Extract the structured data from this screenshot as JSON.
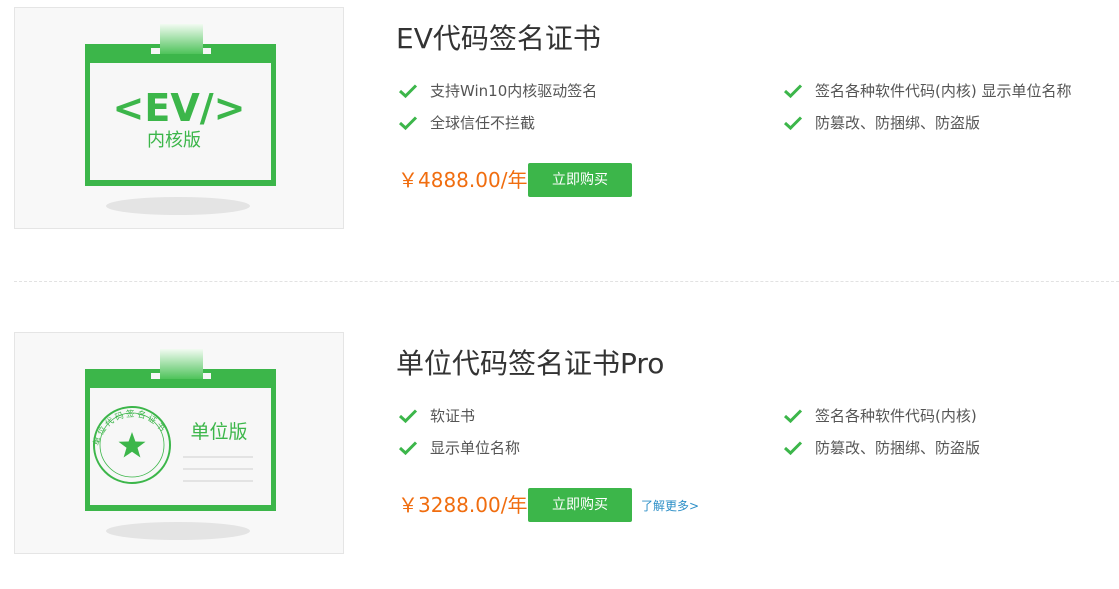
{
  "products": [
    {
      "title": "EV代码签名证书",
      "badge": {
        "main": "<EV/>",
        "sub": "内核版"
      },
      "features": [
        "支持Win10内核驱动签名",
        "全球信任不拦截",
        "签名各种软件代码(内核) 显示单位名称",
        "防篡改、防捆绑、防盗版"
      ],
      "price": "￥4888.00/年",
      "buy_label": "立即购买"
    },
    {
      "title": "单位代码签名证书Pro",
      "badge": {
        "sub": "单位版",
        "seal_text": "单位代码签名证书"
      },
      "features": [
        "软证书",
        "显示单位名称",
        "签名各种软件代码(内核)",
        "防篡改、防捆绑、防盗版"
      ],
      "price": "￥3288.00/年",
      "buy_label": "立即购买",
      "more_link": "了解更多>"
    }
  ],
  "colors": {
    "accent_green": "#3cb64a",
    "price_orange": "#f06d0f",
    "link_blue": "#2d8fc7"
  },
  "icons": {
    "feature_bullet": "check-icon"
  }
}
